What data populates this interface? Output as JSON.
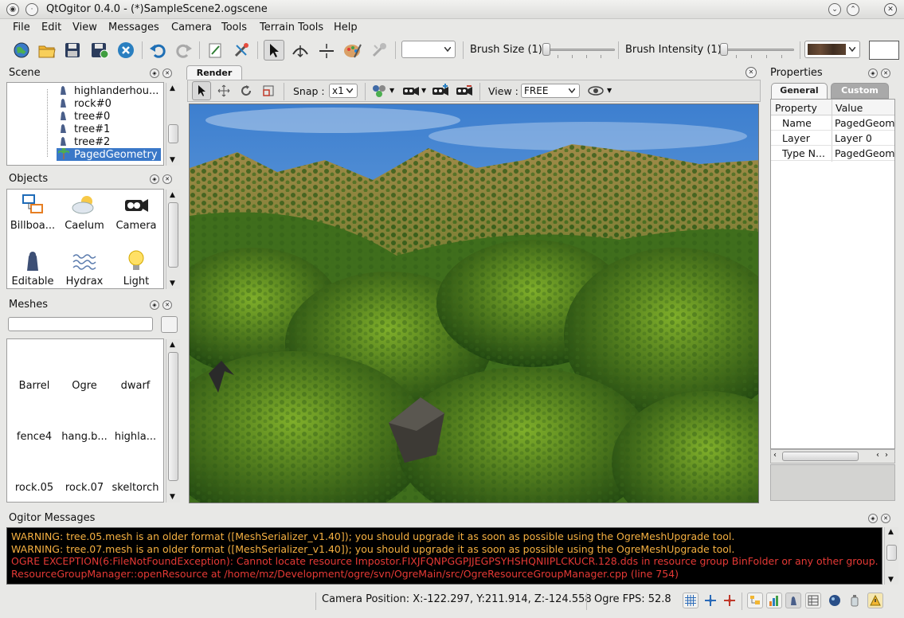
{
  "window": {
    "title": "QtOgitor 0.4.0 - (*)SampleScene2.ogscene"
  },
  "menubar": [
    "File",
    "Edit",
    "View",
    "Messages",
    "Camera",
    "Tools",
    "Terrain Tools",
    "Help"
  ],
  "toolbar": {
    "brush_size_label": "Brush Size (1)",
    "brush_intensity_label": "Brush Intensity (1)",
    "brush_size_value": 1,
    "brush_intensity_value": 1,
    "icons": [
      "globe-icon",
      "open-folder-icon",
      "save-icon",
      "save-all-icon",
      "close-icon",
      "undo-icon",
      "redo-icon",
      "edit-icon",
      "tools-icon",
      "select-arrow-icon",
      "deform-icon",
      "smooth-icon",
      "paint-icon",
      "splat-icon"
    ]
  },
  "scene_panel": {
    "title": "Scene",
    "items": [
      "highlanderhou...",
      "rock#0",
      "tree#0",
      "tree#1",
      "tree#2",
      "PagedGeometry"
    ],
    "selected": "PagedGeometry"
  },
  "objects_panel": {
    "title": "Objects",
    "items": [
      "Billboa...",
      "Caelum",
      "Camera",
      "Editable",
      "Hydrax",
      "Light"
    ]
  },
  "meshes_panel": {
    "title": "Meshes",
    "search_value": "",
    "items": [
      "Barrel",
      "Ogre",
      "dwarf",
      "fence4",
      "hang.b...",
      "highla...",
      "rock.05",
      "rock.07",
      "skeltorch"
    ]
  },
  "render": {
    "tab": "Render",
    "snap_label": "Snap :",
    "snap_value": "x1",
    "view_label": "View :",
    "view_value": "FREE"
  },
  "properties": {
    "title": "Properties",
    "tabs": [
      "General",
      "Custom"
    ],
    "active_tab": "General",
    "columns": [
      "Property",
      "Value"
    ],
    "rows": [
      {
        "property": "Name",
        "value": "PagedGeom"
      },
      {
        "property": "Layer",
        "value": "Layer 0"
      },
      {
        "property": "Type N...",
        "value": "PagedGeom"
      }
    ]
  },
  "messages": {
    "title": "Ogitor Messages",
    "lines": [
      {
        "text": "WARNING: tree.05.mesh is an older format ([MeshSerializer_v1.40]); you should upgrade it as soon as possible using the OgreMeshUpgrade tool.",
        "color": "#f5b041"
      },
      {
        "text": "WARNING: tree.07.mesh is an older format ([MeshSerializer_v1.40]); you should upgrade it as soon as possible using the OgreMeshUpgrade tool.",
        "color": "#f5b041"
      },
      {
        "text": "OGRE EXCEPTION(6:FileNotFoundException): Cannot locate resource Impostor.FIXJFQNPGGPJJEGPSYHSHQNIIPLCKUCR.128.dds in resource group BinFolder or any other group. in",
        "color": "#e53935"
      },
      {
        "text": "ResourceGroupManager::openResource at /home/mz/Development/ogre/svn/OgreMain/src/OgreResourceGroupManager.cpp (line 754)",
        "color": "#e53935"
      }
    ]
  },
  "status": {
    "camera_position": "Camera Position: X:-122.297, Y:211.914, Z:-124.558",
    "fps": "Ogre FPS: 52.8"
  }
}
